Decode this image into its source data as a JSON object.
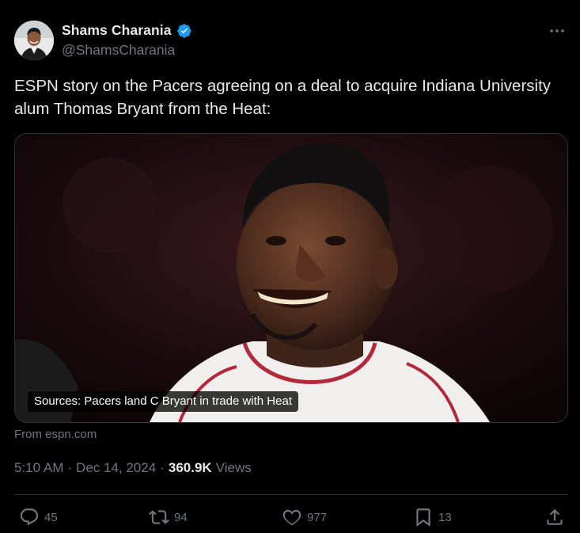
{
  "author": {
    "display_name": "Shams Charania",
    "handle": "@ShamsCharania",
    "verified": true
  },
  "tweet": {
    "text": "ESPN story on the Pacers agreeing on a deal to acquire Indiana University alum Thomas Bryant from the Heat:"
  },
  "card": {
    "caption": "Sources: Pacers land C Bryant in trade with Heat",
    "source": "From espn.com"
  },
  "meta": {
    "time": "5:10 AM",
    "separator": "·",
    "date": "Dec 14, 2024",
    "views_count": "360.9K",
    "views_label": "Views"
  },
  "actions": {
    "replies": "45",
    "reposts": "94",
    "likes": "977",
    "bookmarks": "13"
  },
  "icons": [
    "verified-icon",
    "more-icon",
    "reply-icon",
    "repost-icon",
    "like-icon",
    "bookmark-icon",
    "share-icon"
  ],
  "colors": {
    "background": "#000000",
    "text_primary": "#e7e9ea",
    "text_secondary": "#71767b",
    "verified_blue": "#1d9bf0",
    "border": "#2f3336"
  }
}
